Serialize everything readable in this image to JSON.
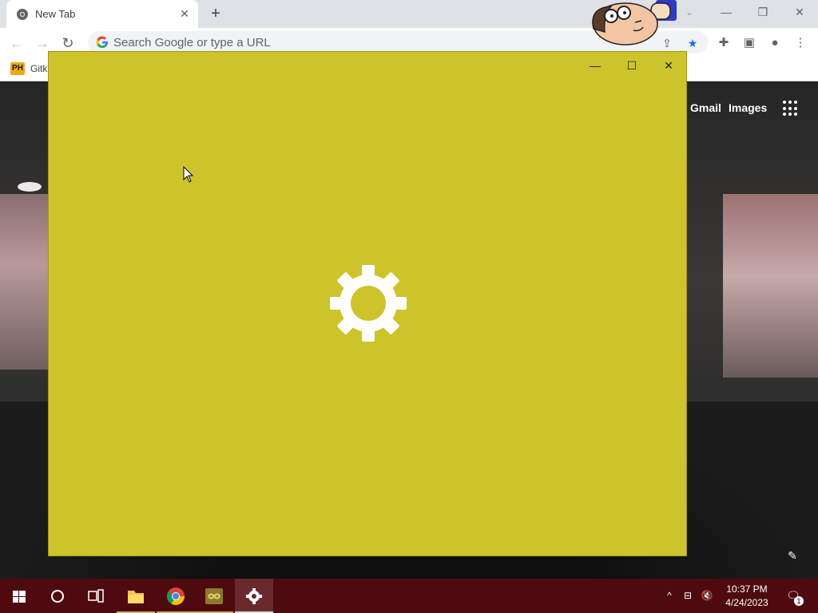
{
  "browser": {
    "tab": {
      "title": "New Tab",
      "favicon": "chrome-icon",
      "close_icon": "✕"
    },
    "new_tab_icon": "+",
    "tab_search_icon": "⌄",
    "window_controls": {
      "minimize": "—",
      "restore": "❐",
      "close": "✕"
    },
    "toolbar": {
      "back_icon": "←",
      "forward_icon": "→",
      "reload_icon": "↻",
      "omnibox_placeholder": "Search Google or type a URL",
      "share_icon": "⇪",
      "bookmark_star_icon": "★",
      "extensions_icon": "✚",
      "side_panel_icon": "▣",
      "profile_icon": "●",
      "menu_icon": "⋮"
    },
    "bookmarks": [
      {
        "badge": "PH",
        "label": "Gitk"
      }
    ]
  },
  "new_tab_page": {
    "links": {
      "gmail": "Gmail",
      "images": "Images"
    },
    "apps_icon": "apps-grid-icon",
    "edit_icon": "✎"
  },
  "loading_window": {
    "controls": {
      "minimize": "—",
      "maximize": "☐",
      "close": "✕"
    },
    "background_color": "#cdc42b",
    "spinner_icon": "gear-icon"
  },
  "taskbar": {
    "start_icon": "windows-icon",
    "search_icon": "○",
    "task_view_icon": "task-view-icon",
    "apps": [
      "file-explorer",
      "chrome",
      "app-launcher",
      "settings"
    ],
    "tray": {
      "chevron": "^",
      "network_icon": "⊟",
      "volume_icon": "🔇",
      "time": "10:37 PM",
      "date": "4/24/2023",
      "notifications_icon": "🗨",
      "notifications_count": "1"
    }
  }
}
